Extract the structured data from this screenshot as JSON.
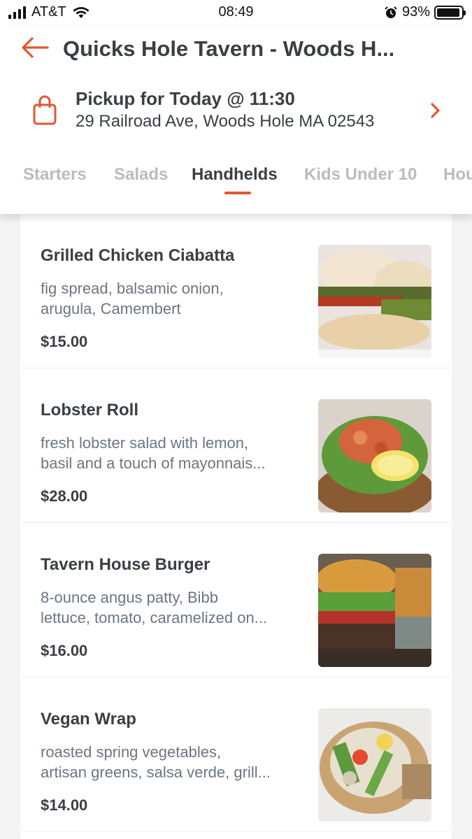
{
  "status_bar": {
    "carrier": "AT&T",
    "time": "08:49",
    "battery": "93%",
    "battery_level": 0.93
  },
  "header": {
    "title": "Quicks Hole Tavern - Woods H...",
    "pickup_title": "Pickup for Today @ 11:30",
    "pickup_address": "29 Railroad Ave, Woods Hole MA 02543"
  },
  "tabs": [
    {
      "label": "Starters"
    },
    {
      "label": "Salads"
    },
    {
      "label": "Handhelds"
    },
    {
      "label": "Kids Under 10"
    },
    {
      "label": "Hou"
    }
  ],
  "active_tab": "Handhelds",
  "colors": {
    "accent": "#e4572e",
    "text": "#3a3f44",
    "muted": "#6b7682",
    "tab_inactive": "#b9bcc0"
  },
  "items": [
    {
      "name": "Grilled Chicken Ciabatta",
      "desc_line1": "fig spread, balsamic onion,",
      "desc_line2": "arugula, Camembert",
      "price": "$15.00",
      "image_icon": "chicken-ciabatta-photo"
    },
    {
      "name": "Lobster Roll",
      "desc_line1": "fresh lobster salad with lemon,",
      "desc_line2": "basil and a touch of mayonnais...",
      "price": "$28.00",
      "image_icon": "lobster-roll-photo"
    },
    {
      "name": "Tavern House Burger",
      "desc_line1": "8-ounce angus patty, Bibb",
      "desc_line2": "lettuce, tomato, caramelized on...",
      "price": "$16.00",
      "image_icon": "burger-photo"
    },
    {
      "name": "Vegan Wrap",
      "desc_line1": "roasted spring vegetables,",
      "desc_line2": "artisan greens, salsa verde, grill...",
      "price": "$14.00",
      "image_icon": "vegan-wrap-photo"
    }
  ]
}
